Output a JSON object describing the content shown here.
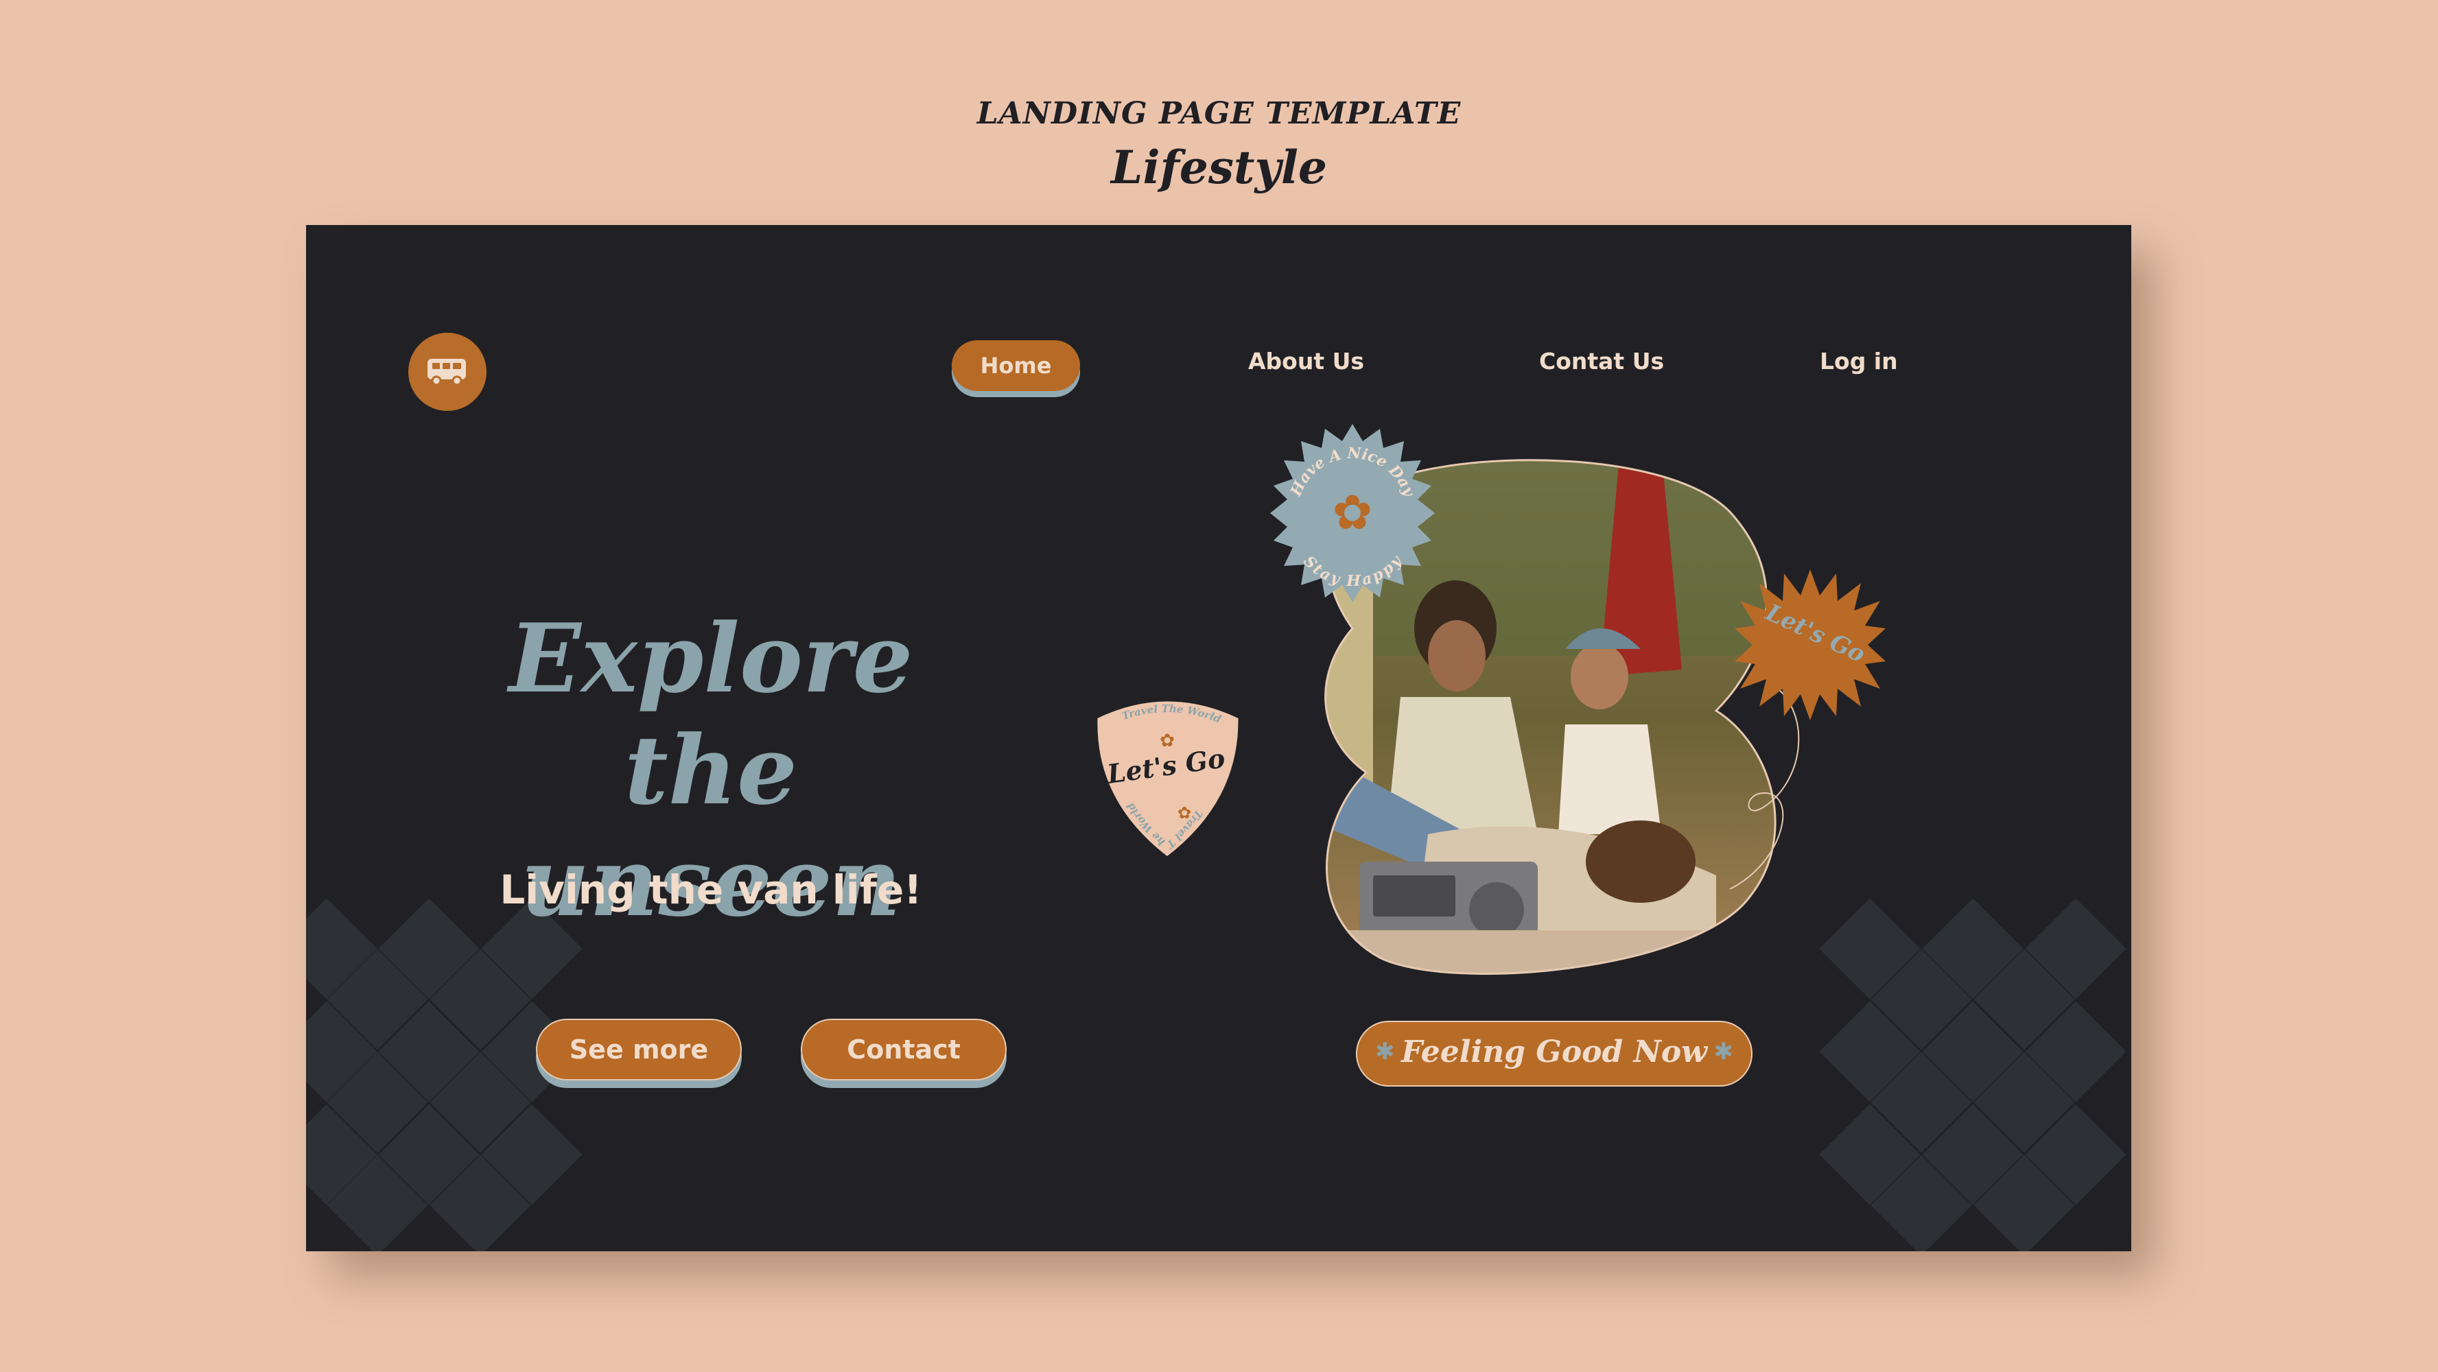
{
  "header": {
    "top_label": "LANDING PAGE TEMPLATE",
    "sub_label": "Lifestyle"
  },
  "nav": {
    "logo_icon": "van-icon",
    "items": [
      {
        "label": "Home",
        "active": true
      },
      {
        "label": "About Us"
      },
      {
        "label": "Contat Us"
      },
      {
        "label": "Log in"
      }
    ]
  },
  "hero": {
    "title_line1": "Explore",
    "title_line2": "the unseen",
    "tagline": "Living the van life!",
    "buttons": [
      {
        "label": "See more"
      },
      {
        "label": "Contact"
      }
    ]
  },
  "stickers": {
    "pick": {
      "main": "Let's Go",
      "ring": "Travel The World"
    },
    "stamp_blue": {
      "top": "Have A Nice Day",
      "bottom": "Stay Happy"
    },
    "stamp_orange": "Let's Go"
  },
  "badge": {
    "label": "Feeling Good Now"
  },
  "colors": {
    "background": "#ebc3ab",
    "panel": "#212125",
    "accent": "#b86a26",
    "slate": "#8ba3aa",
    "cream": "#f1dccb"
  }
}
